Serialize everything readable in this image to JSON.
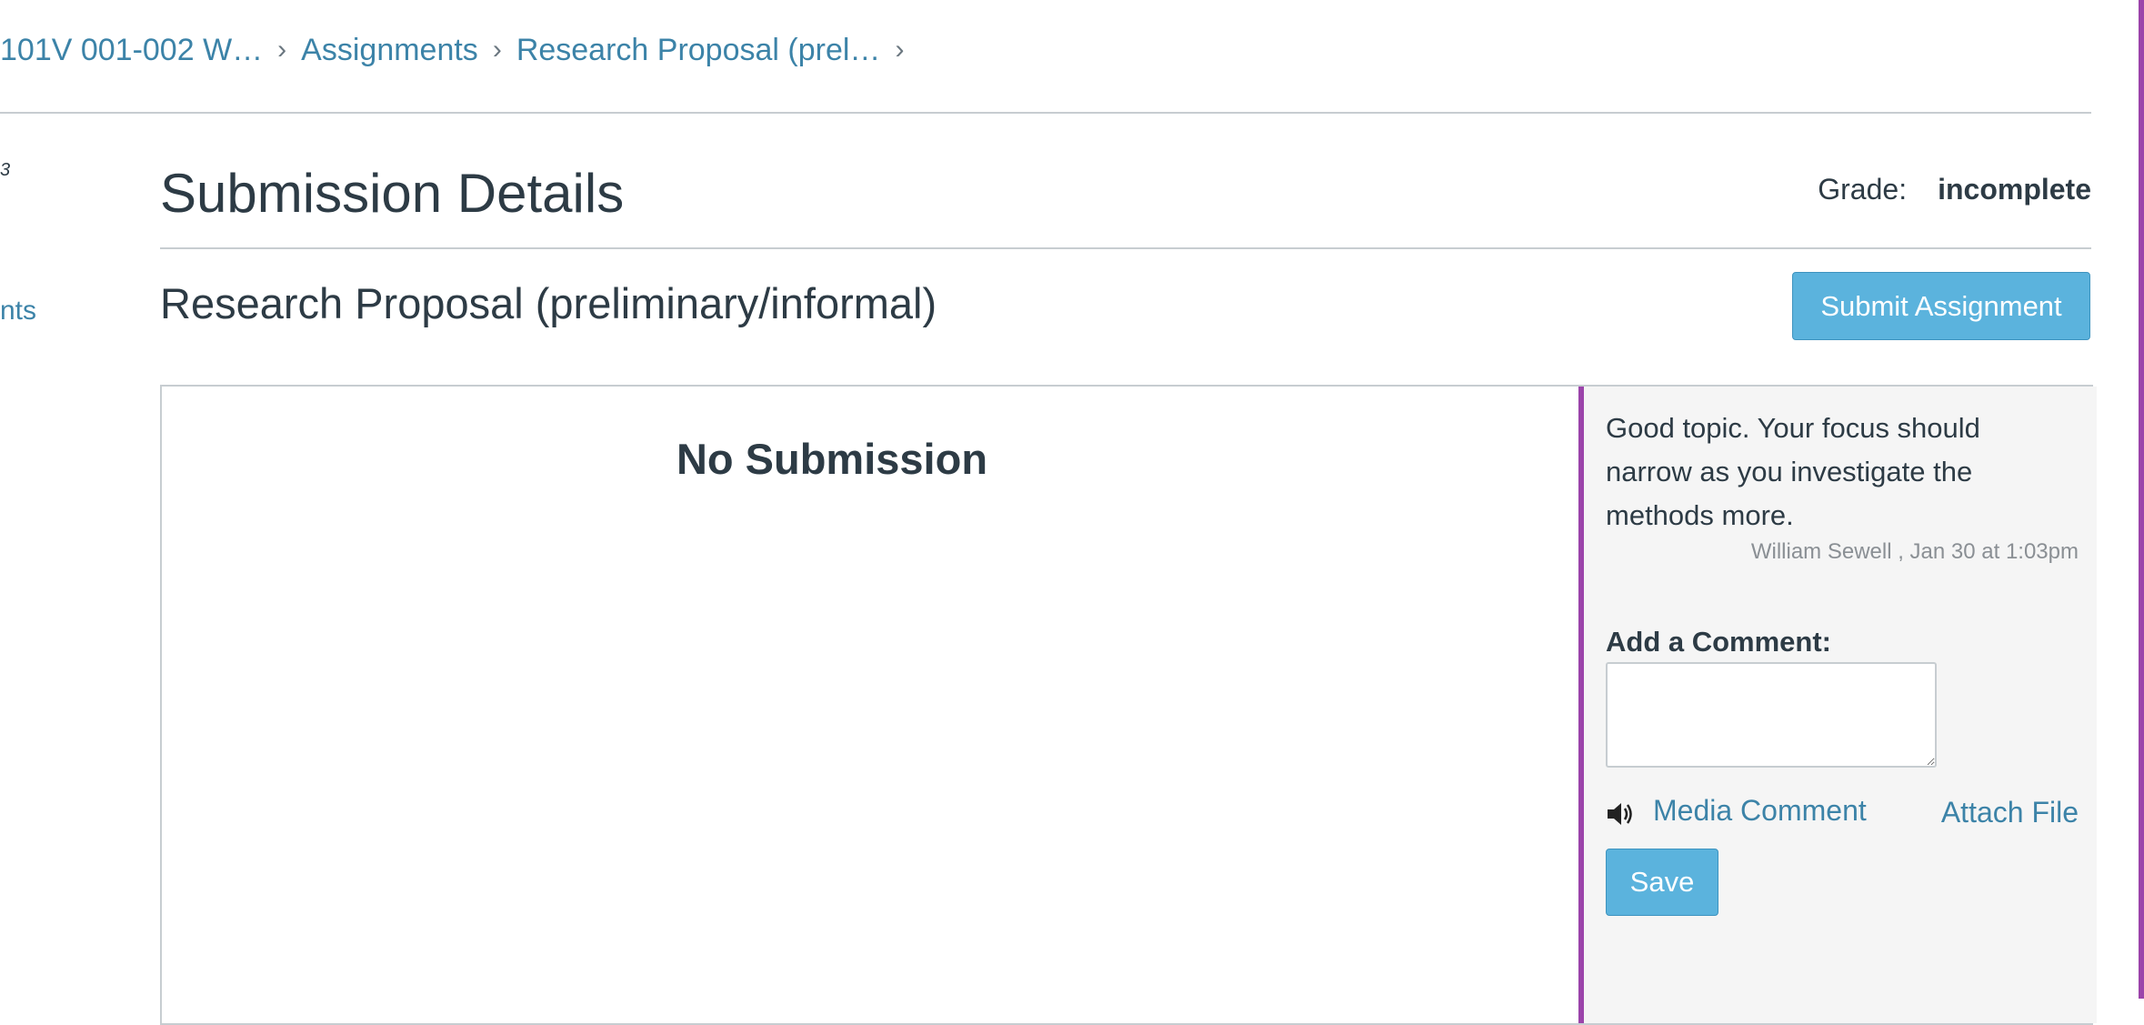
{
  "breadcrumb": {
    "items": [
      "101V 001-002 W…",
      "Assignments",
      "Research Proposal (prel…"
    ]
  },
  "left_nav": {
    "fragment_1": "3",
    "fragment_2": "nts"
  },
  "header": {
    "title": "Submission Details",
    "grade_label": "Grade:",
    "grade_value": "incomplete"
  },
  "assignment": {
    "title": "Research Proposal (preliminary/informal)",
    "submit_label": "Submit Assignment"
  },
  "submission": {
    "status": "No Submission"
  },
  "comments": {
    "items": [
      {
        "text": "Good topic. Your focus should narrow as you investigate the methods more.",
        "meta": "William Sewell , Jan 30 at 1:03pm"
      }
    ],
    "add_label": "Add a Comment:",
    "input_value": "",
    "media_label": "Media Comment",
    "attach_label": "Attach File",
    "save_label": "Save"
  },
  "colors": {
    "link": "#3c83a8",
    "button": "#5bb3dd",
    "accent_border": "#9b44aa"
  },
  "icons": {
    "media": "speaker-icon",
    "separator": "chevron-right-icon"
  }
}
